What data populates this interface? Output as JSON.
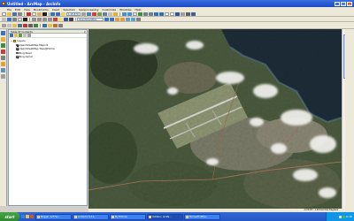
{
  "window": {
    "title": "Untitled - ArcMap - ArcInfo",
    "minimize": "_",
    "maximize": "□",
    "close": "×"
  },
  "menu": [
    "File",
    "Edit",
    "View",
    "Bookmarks",
    "Insert",
    "Selection",
    "Geoprocessing",
    "Customize",
    "Windows",
    "Help"
  ],
  "toolbar": {
    "scale": "1:15,370",
    "layer_select": "OpenStreetMap"
  },
  "toc": {
    "title": "Table Of Contents",
    "close": "×",
    "frame": "Layers",
    "layers": [
      {
        "label": "OpenStreetMap Mapnik",
        "checked": true
      },
      {
        "label": "OpenStreetMap Tiles@Home",
        "checked": true
      },
      {
        "label": "Bing Road",
        "checked": false
      },
      {
        "label": "Bing Aerial",
        "checked": true
      }
    ]
  },
  "statusbar": {
    "coords": "-4.01227  -1.94  Decimal Degrees"
  },
  "taskbar": {
    "start": "start",
    "tasks": [
      {
        "label": "Blogger: Arif Fau...",
        "active": false
      },
      {
        "label": "ArcGis for 9.3.1...",
        "active": false
      },
      {
        "label": "My Pictures",
        "active": false
      },
      {
        "label": "Untitled - ArcMa...",
        "active": true
      },
      {
        "label": "Microsoft Office...",
        "active": false
      }
    ],
    "clock": "11:20"
  },
  "colors": {
    "titlebar": "#1c48c4",
    "taskbar": "#2456c7",
    "start": "#2e8a2e",
    "tray": "#0f96e8",
    "water": "#1f2c38",
    "vegetation": "#3e4a34"
  }
}
